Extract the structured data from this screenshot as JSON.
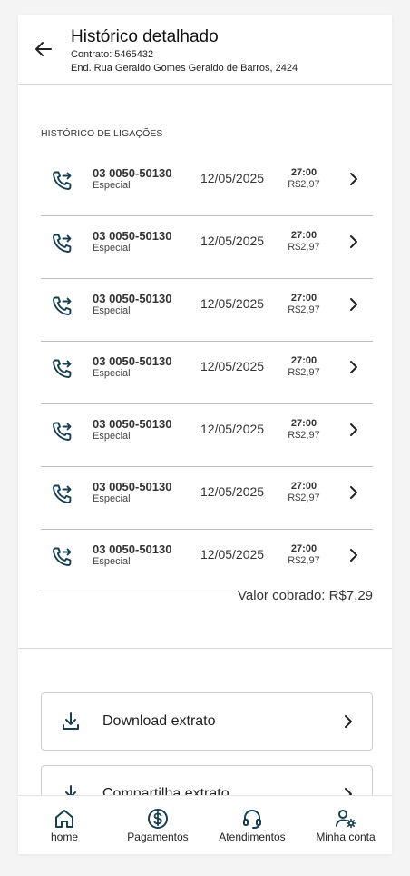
{
  "header": {
    "title": "Histórico detalhado",
    "contract": "Contrato: 5465432",
    "address": "End. Rua Geraldo Gomes Geraldo de Barros, 2424"
  },
  "section_title": "HISTÓRICO DE LIGAÇÕES",
  "calls": [
    {
      "number": "03 0050-50130",
      "type": "Especial",
      "date": "12/05/2025",
      "duration": "27:00",
      "price": "R$2,97"
    },
    {
      "number": "03 0050-50130",
      "type": "Especial",
      "date": "12/05/2025",
      "duration": "27:00",
      "price": "R$2,97"
    },
    {
      "number": "03 0050-50130",
      "type": "Especial",
      "date": "12/05/2025",
      "duration": "27:00",
      "price": "R$2,97"
    },
    {
      "number": "03 0050-50130",
      "type": "Especial",
      "date": "12/05/2025",
      "duration": "27:00",
      "price": "R$2,97"
    },
    {
      "number": "03 0050-50130",
      "type": "Especial",
      "date": "12/05/2025",
      "duration": "27:00",
      "price": "R$2,97"
    },
    {
      "number": "03 0050-50130",
      "type": "Especial",
      "date": "12/05/2025",
      "duration": "27:00",
      "price": "R$2,97"
    },
    {
      "number": "03 0050-50130",
      "type": "Especial",
      "date": "12/05/2025",
      "duration": "27:00",
      "price": "R$2,97"
    }
  ],
  "total": "Valor cobrado: R$7,29",
  "actions": [
    {
      "label": "Download extrato",
      "icon": "download-icon"
    },
    {
      "label": "Compartilha extrato",
      "icon": "download-icon"
    }
  ],
  "nav": [
    {
      "label": "home",
      "icon": "home-icon"
    },
    {
      "label": "Pagamentos",
      "icon": "dollar-circle-icon"
    },
    {
      "label": "Atendimentos",
      "icon": "headset-icon"
    },
    {
      "label": "Minha conta",
      "icon": "user-settings-icon"
    }
  ],
  "colors": {
    "icon_accent": "#173f4f",
    "divider": "#bdbdbd",
    "text": "#333333"
  }
}
